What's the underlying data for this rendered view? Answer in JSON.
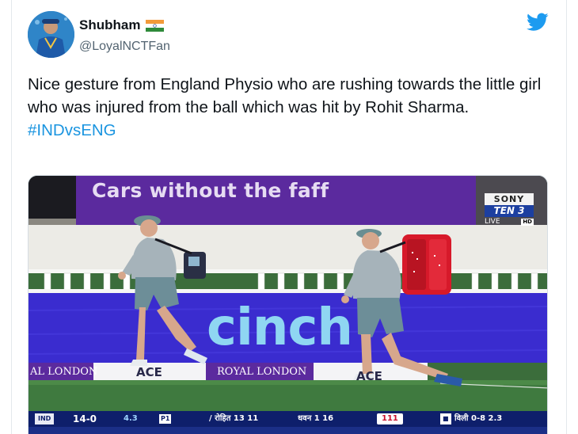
{
  "user": {
    "display_name": "Shubham",
    "handle": "@LoyalNCTFan",
    "flag_icon": "india-flag-icon",
    "avatar_icon": "avatar-cricketer-photo"
  },
  "brand_icon": "twitter-bird-icon",
  "tweet": {
    "text": "Nice gesture from England Physio who are rushing towards the little girl who was injured from the ball which was hit by Rohit Sharma.",
    "hashtag": "#INDvsENG"
  },
  "media": {
    "banner_text": "Cars without the faff",
    "sponsor_text": "cinch",
    "boards": {
      "left": "AL LONDON",
      "ace1": "ACE",
      "middle": "ROYAL LONDON",
      "ace2": "ACE"
    },
    "broadcaster": {
      "network": "SONY",
      "channel": "TEN 3",
      "live": "LIVE",
      "hd": "HD"
    },
    "scoreboard": {
      "team_badge": "IND",
      "score": "14-0",
      "overs": "4.3",
      "pp": "P1",
      "batter1": "/ रोहित 13 11",
      "batter2": "धवन 1 16",
      "ball_speed": "111",
      "bowler": "विली 0-8 2.3"
    }
  },
  "colors": {
    "hashtag": "#1b95e0",
    "twitter_blue": "#1d9bf0",
    "banner_purple": "#5b2a9e",
    "cinch_board": "#3a2ccf",
    "scoreboard_navy": "#0e1f6b"
  }
}
